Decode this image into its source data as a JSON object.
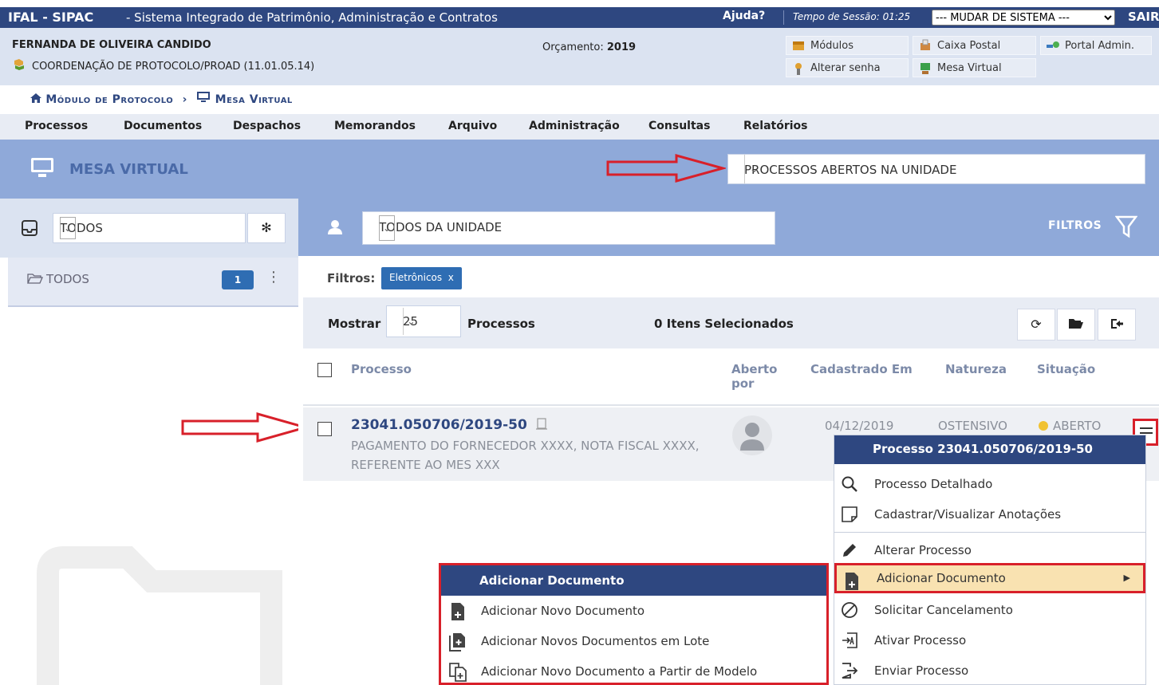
{
  "topbar": {
    "system": "IFAL - SIPAC",
    "system_desc": "- Sistema Integrado de Patrimônio, Administração e Contratos",
    "help": "Ajuda?",
    "session": "Tempo de Sessão: 01:25",
    "switch_system": "--- MUDAR DE SISTEMA ---",
    "logout": "SAIR"
  },
  "user": {
    "name": "FERNANDA DE OLIVEIRA CANDIDO",
    "unit": "COORDENAÇÃO DE PROTOCOLO/PROAD (11.01.05.14)",
    "budget_label": "Orçamento:",
    "budget_year": "2019"
  },
  "quicklinks": {
    "modules": "Módulos",
    "mailbox": "Caixa Postal",
    "admin_portal": "Portal Admin.",
    "change_password": "Alterar senha",
    "virtual_desk": "Mesa Virtual"
  },
  "breadcrumb": {
    "module": "Módulo de Protocolo",
    "separator": "›",
    "page": "Mesa Virtual"
  },
  "menu": [
    "Processos",
    "Documentos",
    "Despachos",
    "Memorandos",
    "Arquivo",
    "Administração",
    "Consultas",
    "Relatórios"
  ],
  "header": {
    "title": "MESA VIRTUAL",
    "view_select": "PROCESSOS ABERTOS NA UNIDADE"
  },
  "sidebar": {
    "group_select": "TODOS",
    "folder_label": "TODOS",
    "folder_count": "1"
  },
  "toolbar": {
    "user_select": "TODOS DA UNIDADE",
    "filters_label": "FILTROS"
  },
  "filters": {
    "label": "Filtros:",
    "chip": "Eletrônicos",
    "chip_remove": "x"
  },
  "listing": {
    "show_label": "Mostrar",
    "page_size": "25",
    "items_label": "Processos",
    "selected": "0 Itens Selecionados"
  },
  "table": {
    "headers": {
      "process": "Processo",
      "opened_by_1": "Aberto",
      "opened_by_2": "por",
      "registered": "Cadastrado Em",
      "nature": "Natureza",
      "status": "Situação"
    },
    "rows": [
      {
        "number": "23041.050706/2019-50",
        "desc": "PAGAMENTO DO FORNECEDOR XXXX, NOTA FISCAL XXXX, REFERENTE AO MES XXX",
        "date": "04/12/2019",
        "nature": "OSTENSIVO",
        "status": "ABERTO"
      }
    ]
  },
  "context_menu": {
    "title": "Processo 23041.050706/2019-50",
    "items": [
      "Processo Detalhado",
      "Cadastrar/Visualizar Anotações",
      "Alterar Processo",
      "Adicionar Documento",
      "Solicitar Cancelamento",
      "Ativar Processo",
      "Enviar Processo"
    ]
  },
  "submenu": {
    "title": "Adicionar Documento",
    "items": [
      "Adicionar Novo Documento",
      "Adicionar Novos Documentos em Lote",
      "Adicionar Novo Documento a Partir de Modelo"
    ]
  },
  "colors": {
    "primary": "#2e4780",
    "accent_blue": "#2f6db3",
    "header_band": "#8fa9d9",
    "highlight": "#f9e2b1",
    "annotation_red": "#d8202a",
    "status_dot": "#f1c232"
  }
}
